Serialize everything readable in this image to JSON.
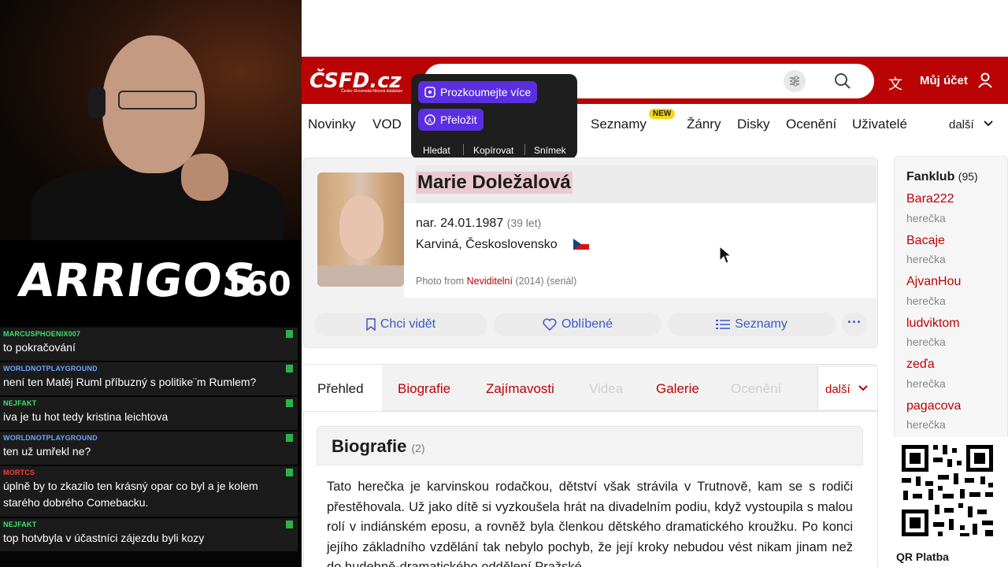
{
  "stream": {
    "brand": "ARRIGOS",
    "number": "160",
    "chat": [
      {
        "user": "MARCUSPHOENIX007",
        "color": "#3ee06b",
        "text": "to pokračování"
      },
      {
        "user": "WORLDNOTPLAYGROUND",
        "color": "#6ea5ff",
        "text": "není ten Matěj Ruml příbuzný s politike¨m Rumlem?"
      },
      {
        "user": "NEJFAKT",
        "color": "#3ee06b",
        "text": "iva je tu hot tedy kristina leichtova"
      },
      {
        "user": "WORLDNOTPLAYGROUND",
        "color": "#6ea5ff",
        "text": "ten už umřekl ne?"
      },
      {
        "user": "MORTCS",
        "color": "#ff3b3b",
        "text": "úplně by to zkazilo ten krásný opar co byl a je kolem starého dobrého Comebacku."
      },
      {
        "user": "NEJFAKT",
        "color": "#3ee06b",
        "text": "top hotvbyla v účastníci zájezdu byli kozy"
      }
    ]
  },
  "site": {
    "logo": "ČSFD.cz",
    "logo_sub": "Česko-Slovenská filmová databáze",
    "account": "Můj účet",
    "nav": [
      "Novinky",
      "VOD",
      "Seznamy",
      "Žánry",
      "Disky",
      "Ocenění",
      "Uživatelé",
      "další"
    ],
    "new_badge": "NEW"
  },
  "popup": {
    "explore": "Prozkoumejte více",
    "translate": "Přeložit",
    "actions": [
      "Hledat",
      "Kopírovat",
      "Snímek"
    ]
  },
  "profile": {
    "name": "Marie Doležalová",
    "born": "nar. 24.01.1987",
    "age": "(39 let)",
    "place": "Karviná, Československo",
    "photo_prefix": "Photo from",
    "photo_link": "Neviditelní",
    "photo_suffix": "(2014) (seriál)",
    "buttons": [
      "Chci vidět",
      "Oblíbené",
      "Seznamy"
    ]
  },
  "tabs": {
    "items": [
      {
        "label": "Přehled",
        "state": "active"
      },
      {
        "label": "Biografie",
        "state": "link"
      },
      {
        "label": "Zajímavosti",
        "state": "link"
      },
      {
        "label": "Videa",
        "state": "disabled"
      },
      {
        "label": "Galerie",
        "state": "link"
      },
      {
        "label": "Ocenění",
        "state": "disabled"
      }
    ],
    "more": "další"
  },
  "bio": {
    "title": "Biografie",
    "count": "(2)",
    "text": "Tato herečka je karvinskou rodačkou, dětství však strávila v Trutnově, kam se s rodiči přestěhovala. Už jako dítě si vyzkoušela hrát na divadelním podiu, když vystoupila s malou rolí v indiánském eposu, a rovněž byla členkou dětského dramatického kroužku. Po konci jejího základního vzdělání tak nebylo pochyb, že její kroky nebudou vést nikam jinam než do hudebně-dramatického oddělení Pražské"
  },
  "fanklub": {
    "title": "Fanklub",
    "count": "(95)",
    "members": [
      {
        "name": "Bara222",
        "role": "herečka"
      },
      {
        "name": "Bacaje",
        "role": "herečka"
      },
      {
        "name": "AjvanHou",
        "role": "herečka"
      },
      {
        "name": "ludviktom",
        "role": "herečka"
      },
      {
        "name": "zeďa",
        "role": "herečka"
      },
      {
        "name": "pagacova",
        "role": "herečka"
      }
    ]
  },
  "qr_label": "QR Platba",
  "colors": {
    "brand_red": "#ba0305",
    "accent_blue": "#3b5ac4",
    "popup_purple": "#5b2fe0",
    "new_badge": "#f6d416"
  }
}
